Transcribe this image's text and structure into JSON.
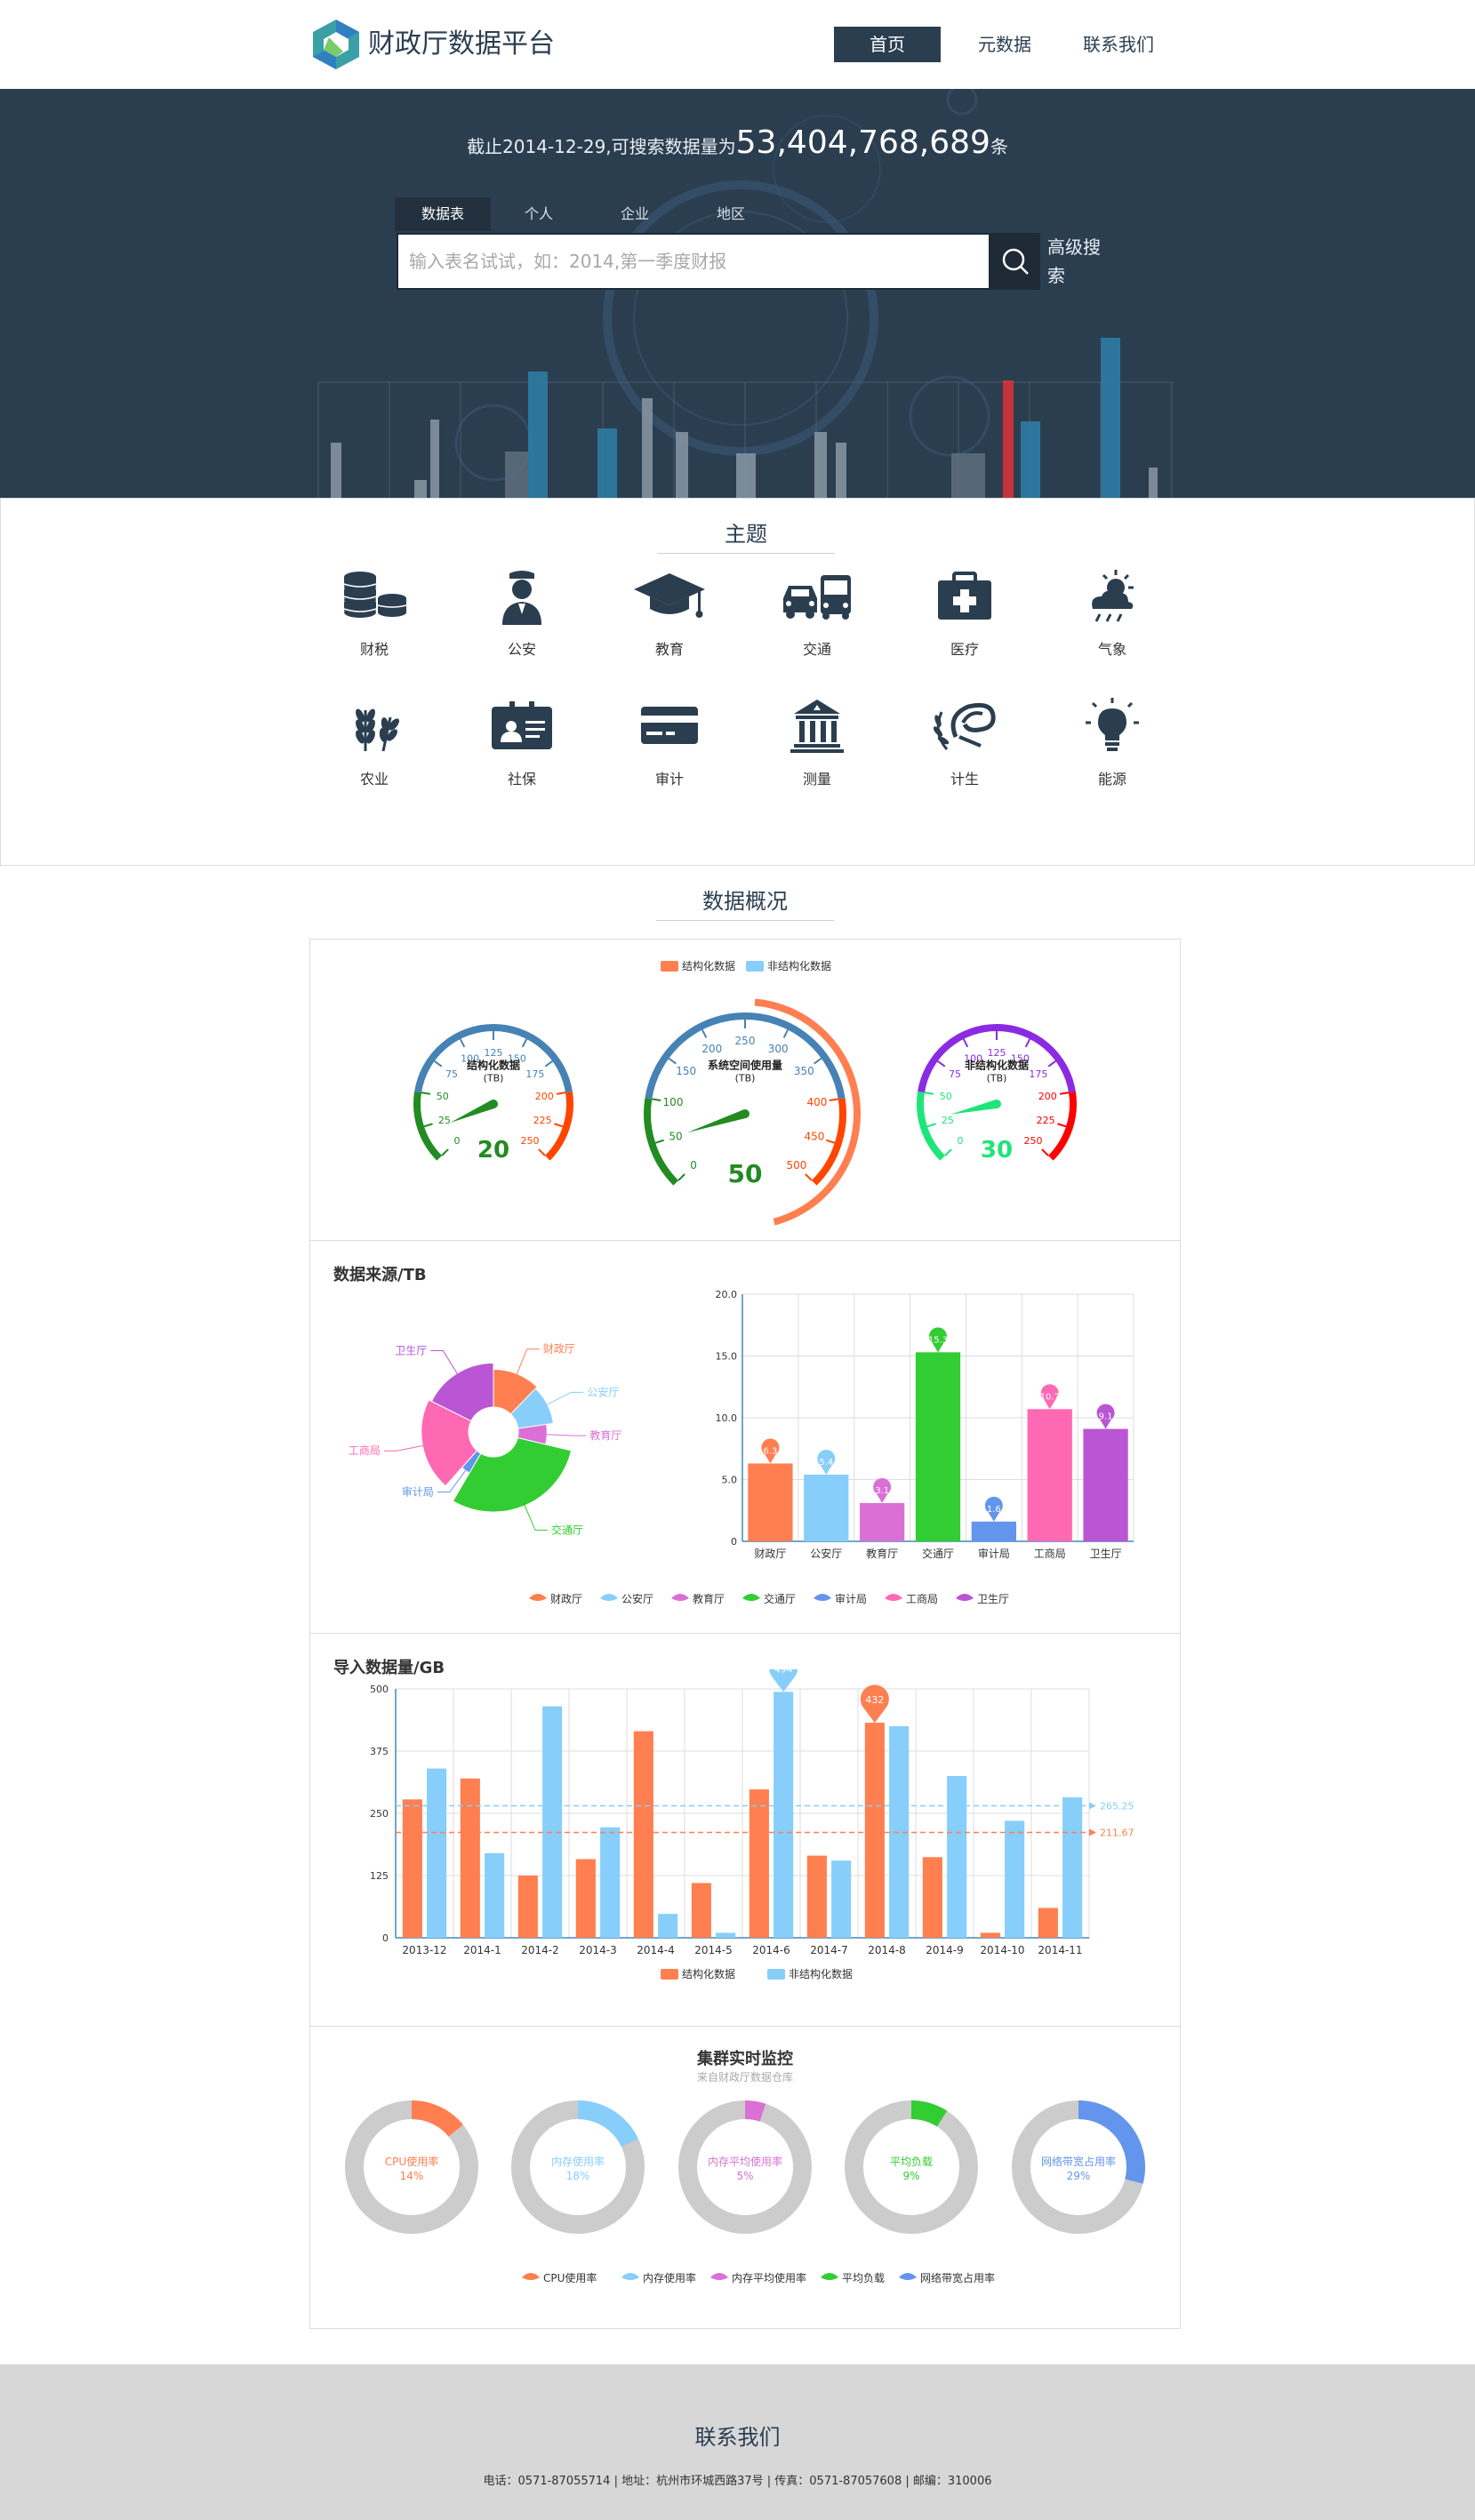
{
  "header": {
    "brand": "财政厅数据平台",
    "nav": [
      {
        "label": "首页"
      },
      {
        "label": "元数据"
      },
      {
        "label": "联系我们"
      }
    ]
  },
  "hero": {
    "stat_prefix": "截止2014-12-29,可搜索数据量为",
    "stat_value": "53,404,768,689",
    "stat_suffix": "条",
    "tabs": [
      {
        "label": "数据表"
      },
      {
        "label": "个人"
      },
      {
        "label": "企业"
      },
      {
        "label": "地区"
      }
    ],
    "search_placeholder": "输入表名试试，如：2014,第一季度财报",
    "advanced_label": "高级搜索"
  },
  "theme": {
    "title": "主题",
    "items": [
      {
        "label": "财税",
        "icon": "coins-icon"
      },
      {
        "label": "公安",
        "icon": "police-icon"
      },
      {
        "label": "教育",
        "icon": "graduation-cap-icon"
      },
      {
        "label": "交通",
        "icon": "car-bus-icon"
      },
      {
        "label": "医疗",
        "icon": "medical-kit-icon"
      },
      {
        "label": "气象",
        "icon": "weather-icon"
      },
      {
        "label": "农业",
        "icon": "wheat-icon"
      },
      {
        "label": "社保",
        "icon": "id-card-icon"
      },
      {
        "label": "审计",
        "icon": "credit-card-icon"
      },
      {
        "label": "测量",
        "icon": "building-icon"
      },
      {
        "label": "计生",
        "icon": "laurel-icon"
      },
      {
        "label": "能源",
        "icon": "lightbulb-icon"
      }
    ]
  },
  "overview": {
    "title": "数据概况",
    "sources_title": "数据来源/TB",
    "imports_title": "导入数据量/GB",
    "cluster_title": "集群实时监控",
    "cluster_subtitle": "来自财政厅数据仓库"
  },
  "chart_data": [
    {
      "type": "gauge",
      "legend": [
        "结构化数据",
        "非结构化数据"
      ],
      "gauges": [
        {
          "name": "结构化数据",
          "unit": "(TB)",
          "min": 0,
          "max": 250,
          "value": 20,
          "color": "#228b22"
        },
        {
          "name": "系统空间使用量",
          "unit": "(TB)",
          "min": 0,
          "max": 500,
          "value": 50,
          "color": "#228b22"
        },
        {
          "name": "非结构化数据",
          "unit": "(TB)",
          "min": 0,
          "max": 250,
          "value": 30,
          "color": "#1ee57a"
        }
      ]
    },
    {
      "type": "pie",
      "subtype": "rose",
      "title": "数据来源/TB",
      "slices": [
        {
          "name": "财政厅",
          "value": 6.3,
          "color": "#ff7f50"
        },
        {
          "name": "公安厅",
          "value": 5.4,
          "color": "#87cefa"
        },
        {
          "name": "教育厅",
          "value": 3.1,
          "color": "#da70d6"
        },
        {
          "name": "交通厅",
          "value": 15.3,
          "color": "#32cd32"
        },
        {
          "name": "审计局",
          "value": 1.6,
          "color": "#6495ed"
        },
        {
          "name": "工商局",
          "value": 10.7,
          "color": "#ff69b4"
        },
        {
          "name": "卫生厅",
          "value": 9.1,
          "color": "#ba55d3"
        }
      ]
    },
    {
      "type": "bar",
      "categories": [
        "财政厅",
        "公安厅",
        "教育厅",
        "交通厅",
        "审计局",
        "工商局",
        "卫生厅"
      ],
      "values": [
        6.3,
        5.4,
        3.1,
        15.3,
        1.6,
        10.7,
        9.1
      ],
      "labels": [
        "6.3",
        "5.4",
        "3.1",
        "15.3",
        "1.6",
        "10.7",
        "9.1"
      ],
      "colors": [
        "#ff7f50",
        "#87cefa",
        "#da70d6",
        "#32cd32",
        "#6495ed",
        "#ff69b4",
        "#ba55d3"
      ],
      "ylim": [
        0,
        20
      ],
      "yticks": [
        "0",
        "5.0",
        "10.0",
        "15.0",
        "20.0"
      ]
    },
    {
      "type": "bar",
      "title": "导入数据量/GB",
      "categories": [
        "2013-12",
        "2014-1",
        "2014-2",
        "2014-3",
        "2014-4",
        "2014-5",
        "2014-6",
        "2014-7",
        "2014-8",
        "2014-9",
        "2014-10",
        "2014-11"
      ],
      "series": [
        {
          "name": "结构化数据",
          "color": "#ff7f50",
          "values": [
            278,
            320,
            125,
            158,
            415,
            110,
            298,
            165,
            432,
            162,
            10,
            60
          ],
          "avg": 211.67,
          "avg_label": "211.67"
        },
        {
          "name": "非结构化数据",
          "color": "#87cefa",
          "values": [
            340,
            170,
            465,
            222,
            48,
            10,
            494,
            155,
            425,
            325,
            235,
            282
          ],
          "avg": 265.25,
          "avg_label": "265.25"
        }
      ],
      "max_marks": [
        {
          "series": 1,
          "index": 6,
          "label": "494"
        },
        {
          "series": 0,
          "index": 8,
          "label": "432"
        }
      ],
      "ylim": [
        0,
        500
      ],
      "yticks": [
        "0",
        "125",
        "250",
        "375",
        "500"
      ]
    },
    {
      "type": "pie",
      "subtype": "donut",
      "title": "集群实时监控",
      "items": [
        {
          "name": "CPU使用率",
          "value": 14,
          "label": "14%",
          "color": "#ff7f50"
        },
        {
          "name": "内存使用率",
          "value": 18,
          "label": "18%",
          "color": "#87cefa"
        },
        {
          "name": "内存平均使用率",
          "value": 5,
          "label": "5%",
          "color": "#da70d6"
        },
        {
          "name": "平均负载",
          "value": 9,
          "label": "9%",
          "color": "#32cd32"
        },
        {
          "name": "网络带宽占用率",
          "value": 29,
          "label": "29%",
          "color": "#6495ed"
        }
      ]
    }
  ],
  "footer": {
    "title": "联系我们",
    "info": "电话：0571-87055714 | 地址：杭州市环城西路37号 | 传真：0571-87057608 | 邮编：310006"
  }
}
